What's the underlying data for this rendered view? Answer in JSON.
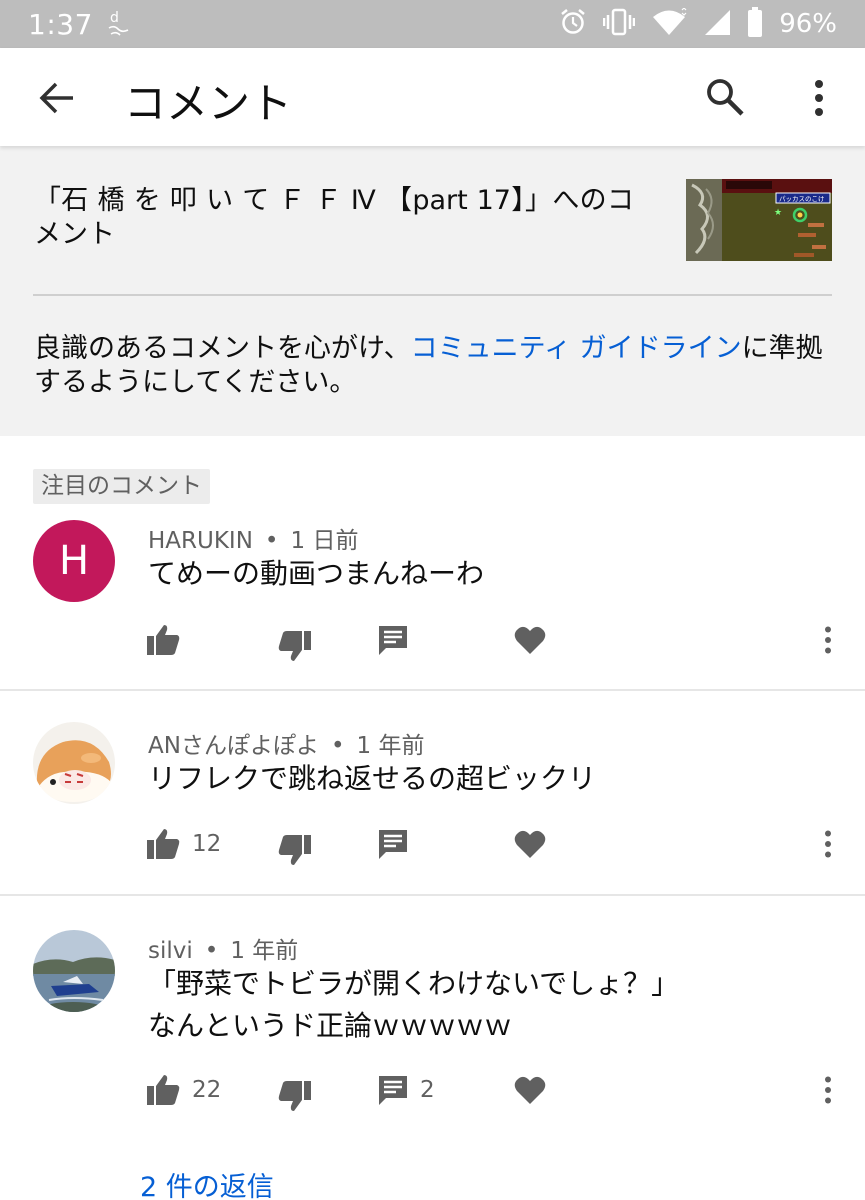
{
  "status_bar": {
    "time": "1:37",
    "battery": "96%",
    "icons": [
      "docomo-d-icon",
      "alarm-icon",
      "vibrate-icon",
      "wifi-icon",
      "signal-icon",
      "battery-icon"
    ]
  },
  "app_bar": {
    "title": "コメント",
    "icons": [
      "back-arrow-icon",
      "search-icon",
      "more-vert-icon"
    ]
  },
  "video": {
    "title": "「石 橋 を 叩 い て Ｆ Ｆ Ⅳ 【part 17】」へのコメント",
    "guideline_prefix": "良識のあるコメントを心がけ、",
    "guideline_link": "コミュニティ ガイドライン",
    "guideline_suffix": "に準拠するようにしてください。",
    "thumbnail_badge": "パッカスのこけ"
  },
  "pinned_label": "注目のコメント",
  "comments": [
    {
      "author": "HARUKIN",
      "avatar_letter": "H",
      "time": "1 日前",
      "text_lines": [
        "てめーの動画つまんねーわ"
      ],
      "likes": "",
      "replies": ""
    },
    {
      "author": "ANさんぽよぽよ",
      "time": "1 年前",
      "text_lines": [
        "リフレクで跳ね返せるの超ビックリ"
      ],
      "likes": "12",
      "replies": ""
    },
    {
      "author": "silvi",
      "time": "1 年前",
      "text_lines": [
        "「野菜でトビラが開くわけないでしょ？」",
        "なんというド正論ｗｗｗｗｗ"
      ],
      "likes": "22",
      "replies": "2"
    }
  ],
  "replies_link": "2 件の返信",
  "colors": {
    "link_blue": "#065fd4",
    "avatar_h": "#c2185b",
    "header_bg": "#f2f2f2",
    "status_bar_bg": "#bdbdbd"
  }
}
